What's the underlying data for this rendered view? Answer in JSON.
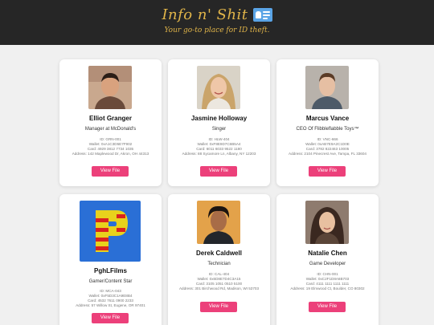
{
  "header": {
    "title": "Info n' Shit",
    "tagline": "Your go-to place for ID theft.",
    "icon": "id-card-icon",
    "title_color": "#e0b449",
    "background_color": "#262626"
  },
  "accent_color": "#ec407a",
  "profiles": [
    {
      "name": "Elliot Granger",
      "role": "Manager at McDonald's",
      "id": "ID: GRN-001",
      "wallet": "Wallet: 0xA1C3D5E7F902",
      "card": "Card: 4929 3812 7734 1035",
      "address": "Address: 142 Maplewood Dr, Akron, OH 44313",
      "button": "View File"
    },
    {
      "name": "Jasmine Holloway",
      "role": "Singer",
      "id": "ID: HLW-404",
      "wallet": "Wallet: 0xF8E9D7C6B5A4",
      "card": "Card: 6011 6033 9522 1180",
      "address": "Address: 88 Sycamore Ln, Albany, NY 12203",
      "button": "View File"
    },
    {
      "name": "Marcus Vance",
      "role": "CEO Of Flibbleflabble Toys™",
      "id": "ID: VNC-666",
      "wallet": "Wallet: 0xAB7E9A2C1D0E",
      "card": "Card: 3782 822463 10005",
      "address": "Address: 2104 Pinecrest Ave, Tampa, FL 33604",
      "button": "View File"
    },
    {
      "name": "PghLFilms",
      "role": "Gamer/Content Star",
      "id": "ID: MCA-043",
      "wallet": "Wallet: 0xF5D3C1A9E8B4",
      "card": "Card: 4532 7611 0900 2233",
      "address": "Address: 57 Willow St, Eugene, OR 97401",
      "button": "View File"
    },
    {
      "name": "Derek Caldwell",
      "role": "Technician",
      "id": "ID: CAL-404",
      "wallet": "Wallet: 0x6D8E7D4C3A15",
      "card": "Card: 3105 1051 0510 5100",
      "address": "Address: 301 Birchwood Rd, Madison, WI 53703",
      "button": "View File"
    },
    {
      "name": "Natalie Chen",
      "role": "Game Developer",
      "id": "ID: CHN-001",
      "wallet": "Wallet: 0xC2F1D8A6B703",
      "card": "Card: 4111 1111 1111 1111",
      "address": "Address: 19 Elmwood Ct, Boulder, CO 80302",
      "button": "View File"
    }
  ]
}
